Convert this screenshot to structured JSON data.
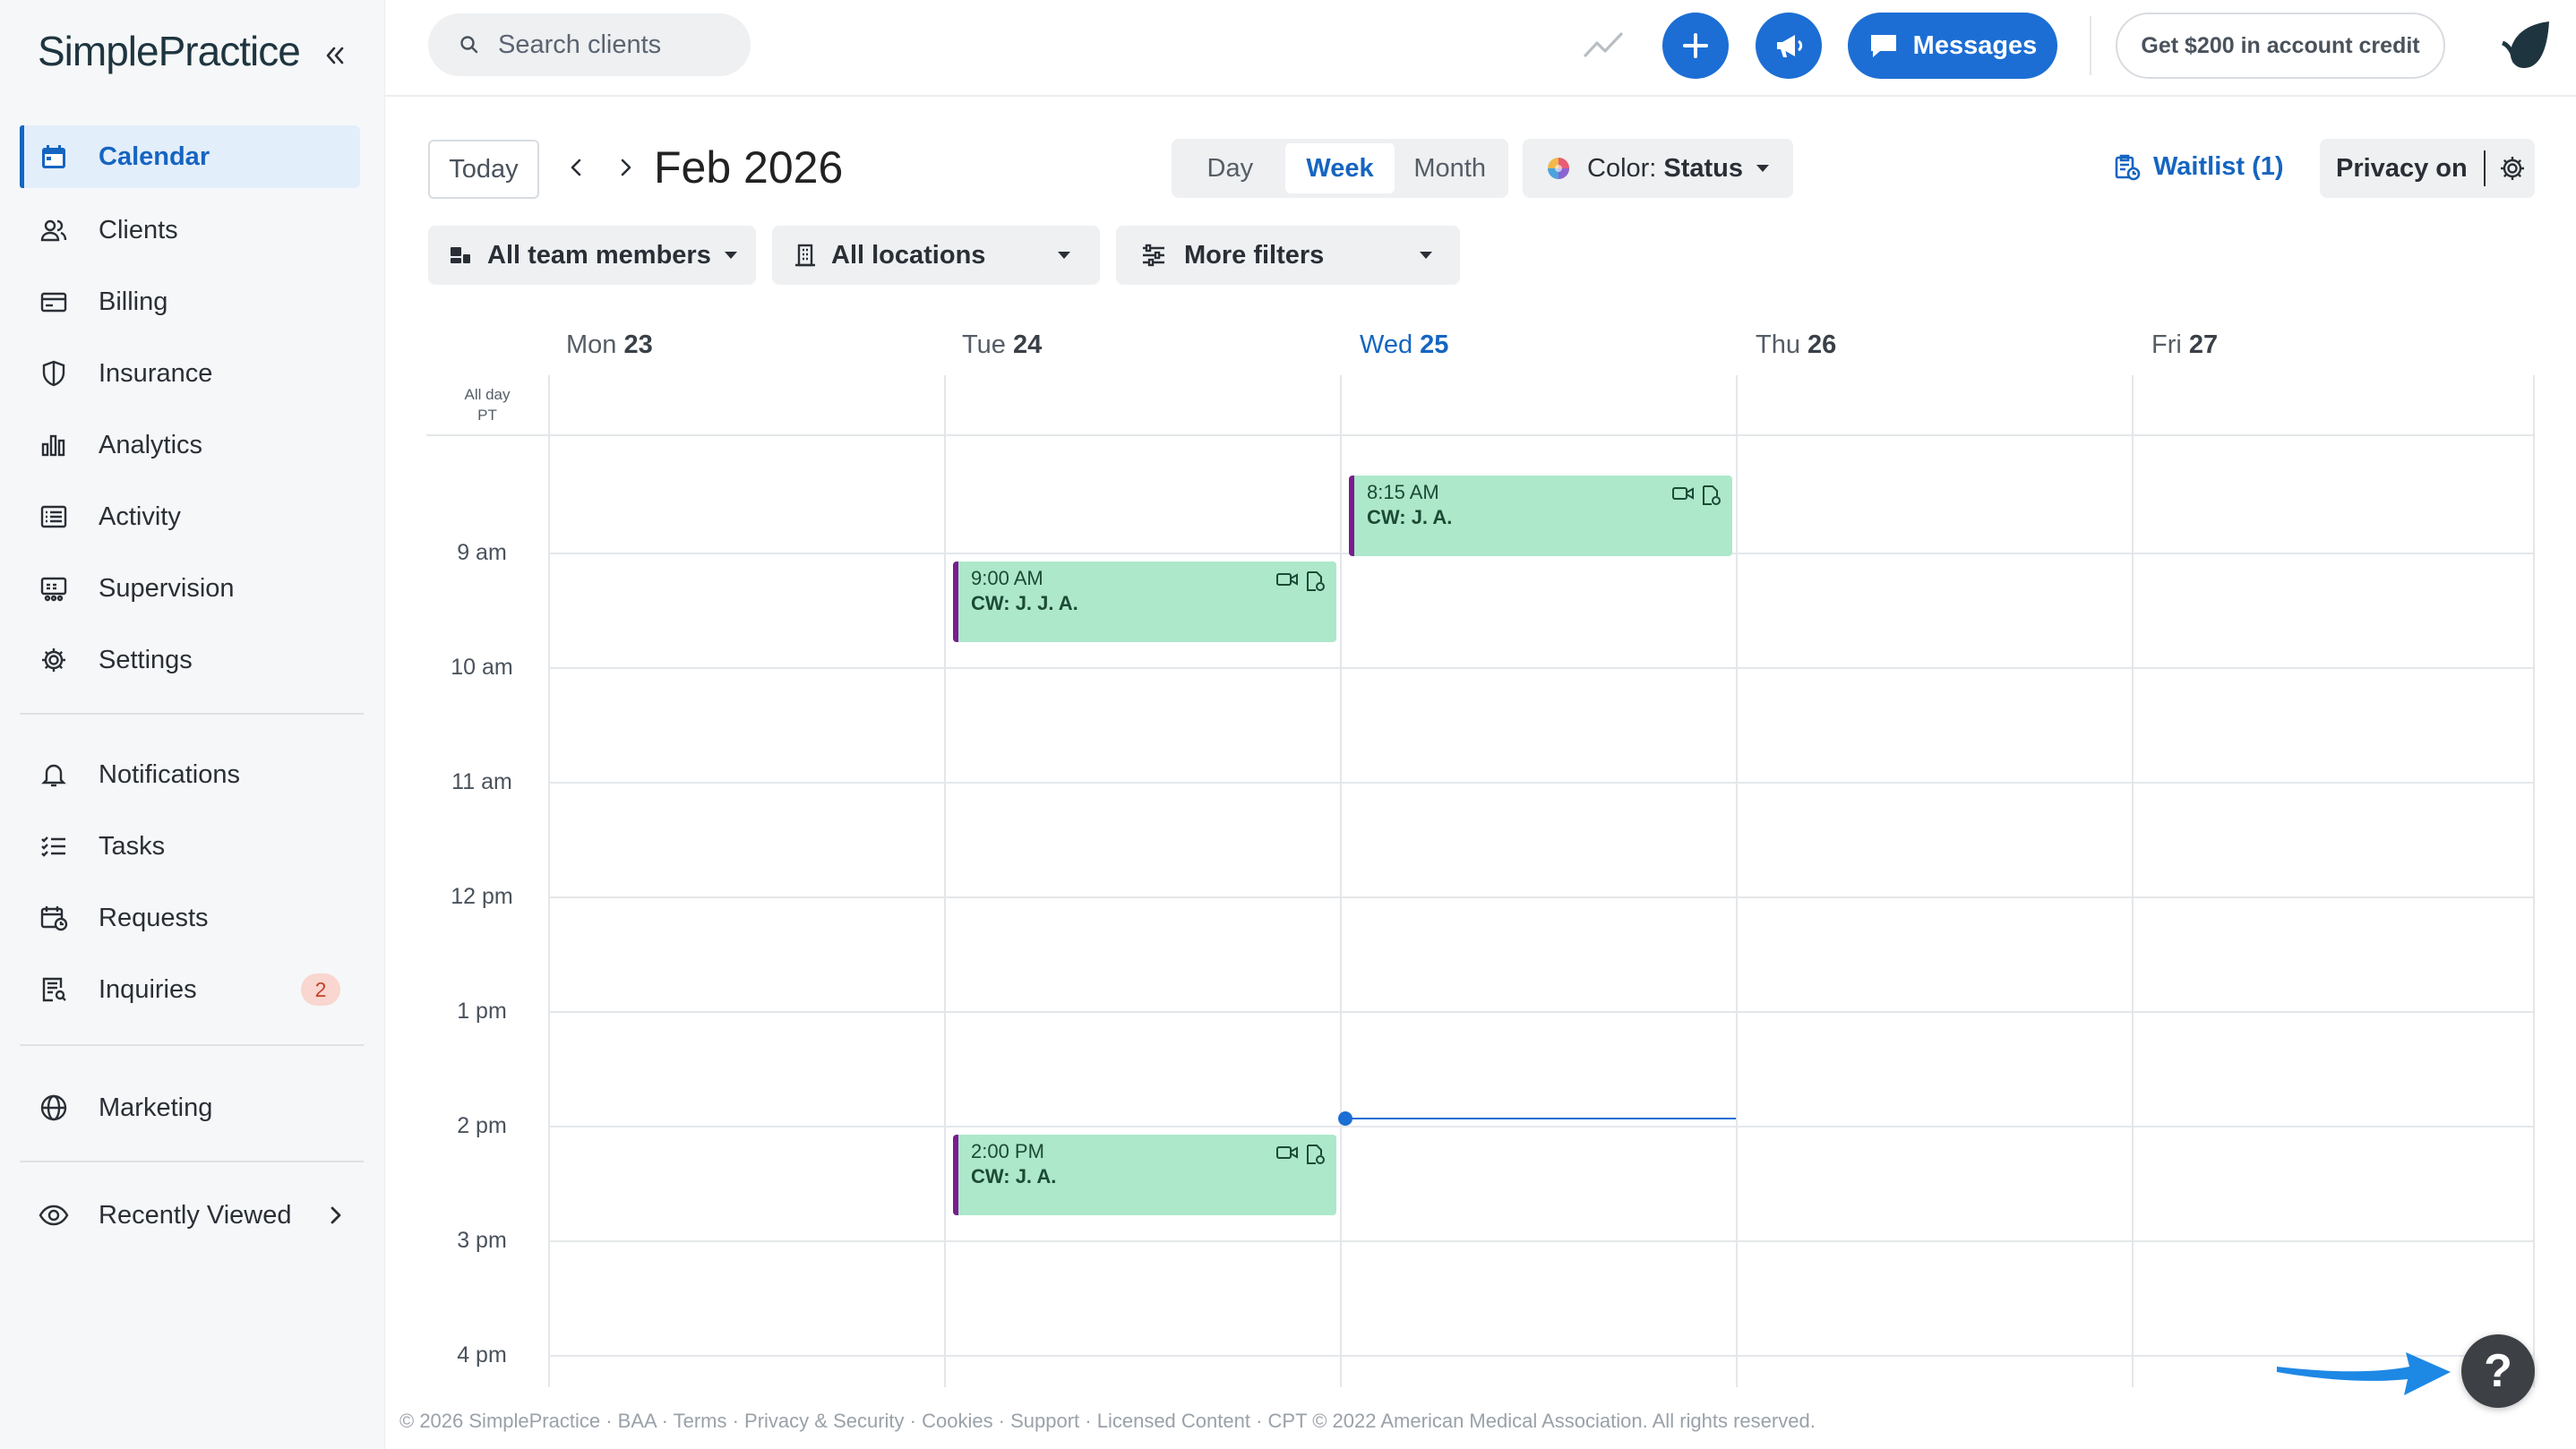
{
  "app": {
    "logo": "SimplePractice",
    "colors": {
      "accent": "#1565c0",
      "event": "#ade8cb",
      "event_border": "#7a1d8e",
      "badge_bg": "#f9d6cf"
    }
  },
  "sidebar": {
    "items": [
      {
        "label": "Calendar",
        "icon": "calendar-icon",
        "active": true
      },
      {
        "label": "Clients",
        "icon": "clients-icon"
      },
      {
        "label": "Billing",
        "icon": "billing-icon"
      },
      {
        "label": "Insurance",
        "icon": "shield-icon"
      },
      {
        "label": "Analytics",
        "icon": "bar-chart-icon"
      },
      {
        "label": "Activity",
        "icon": "list-icon"
      },
      {
        "label": "Supervision",
        "icon": "supervision-icon"
      },
      {
        "label": "Settings",
        "icon": "gear-icon"
      },
      {
        "label": "Notifications",
        "icon": "bell-icon"
      },
      {
        "label": "Tasks",
        "icon": "tasks-icon"
      },
      {
        "label": "Requests",
        "icon": "requests-icon"
      },
      {
        "label": "Inquiries",
        "icon": "inquiries-icon",
        "badge": "2"
      },
      {
        "label": "Marketing",
        "icon": "globe-icon"
      },
      {
        "label": "Recently Viewed",
        "icon": "eye-icon"
      }
    ]
  },
  "topbar": {
    "search_placeholder": "Search clients",
    "messages_label": "Messages",
    "credit_label": "Get $200 in account credit"
  },
  "toolbar": {
    "today_label": "Today",
    "month_title": "Feb 2026",
    "views": [
      "Day",
      "Week",
      "Month"
    ],
    "active_view": "Week",
    "color_prefix": "Color:",
    "color_value": "Status",
    "waitlist_label": "Waitlist (1)",
    "privacy_label": "Privacy on"
  },
  "filters": {
    "team": "All team members",
    "locations": "All locations",
    "more": "More filters"
  },
  "calendar": {
    "all_day": "All day",
    "timezone": "PT",
    "days": [
      {
        "name": "Mon",
        "num": "23"
      },
      {
        "name": "Tue",
        "num": "24"
      },
      {
        "name": "Wed",
        "num": "25",
        "today": true
      },
      {
        "name": "Thu",
        "num": "26"
      },
      {
        "name": "Fri",
        "num": "27"
      }
    ],
    "hours": [
      "9 am",
      "10 am",
      "11 am",
      "12 pm",
      "1 pm",
      "2 pm",
      "3 pm",
      "4 pm"
    ],
    "events": [
      {
        "day": "Wed 25",
        "time": "8:15 AM",
        "client": "CW: J. A."
      },
      {
        "day": "Tue 24",
        "time": "9:00 AM",
        "client": "CW: J. J. A."
      },
      {
        "day": "Tue 24",
        "time": "2:00 PM",
        "client": "CW: J. A."
      }
    ]
  },
  "footer": {
    "text": "© 2026 SimplePractice · BAA · Terms · Privacy & Security · Cookies · Support · Licensed Content · CPT © 2022 American Medical Association. All rights reserved."
  },
  "help_label": "?"
}
